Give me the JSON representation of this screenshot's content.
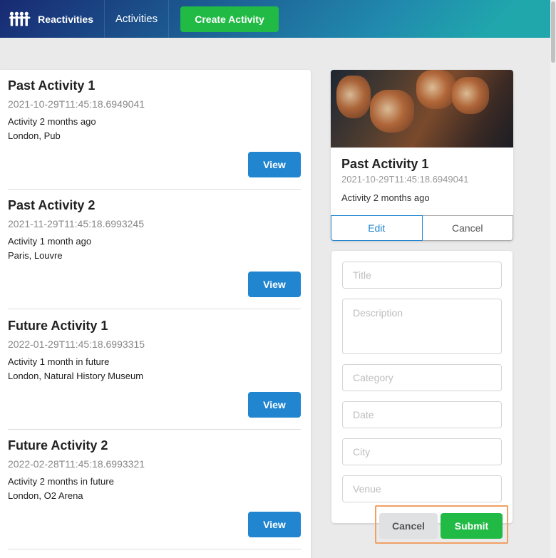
{
  "navbar": {
    "brand": "Reactivities",
    "activities_link": "Activities",
    "create_button": "Create Activity"
  },
  "activities": [
    {
      "title": "Past Activity 1",
      "date": "2021-10-29T11:45:18.6949041",
      "description": "Activity 2 months ago",
      "venue": "London, Pub",
      "view_label": "View"
    },
    {
      "title": "Past Activity 2",
      "date": "2021-11-29T11:45:18.6993245",
      "description": "Activity 1 month ago",
      "venue": "Paris, Louvre",
      "view_label": "View"
    },
    {
      "title": "Future Activity 1",
      "date": "2022-01-29T11:45:18.6993315",
      "description": "Activity 1 month in future",
      "venue": "London, Natural History Museum",
      "view_label": "View"
    },
    {
      "title": "Future Activity 2",
      "date": "2022-02-28T11:45:18.6993321",
      "description": "Activity 2 months in future",
      "venue": "London, O2 Arena",
      "view_label": "View"
    }
  ],
  "detail": {
    "title": "Past Activity 1",
    "date": "2021-10-29T11:45:18.6949041",
    "description": "Activity 2 months ago",
    "edit_label": "Edit",
    "cancel_label": "Cancel"
  },
  "form": {
    "title_placeholder": "Title",
    "description_placeholder": "Description",
    "category_placeholder": "Category",
    "date_placeholder": "Date",
    "city_placeholder": "City",
    "venue_placeholder": "Venue",
    "cancel_label": "Cancel",
    "submit_label": "Submit"
  },
  "colors": {
    "primary": "#2185d0",
    "positive": "#21ba45",
    "highlight": "#f0a064"
  }
}
